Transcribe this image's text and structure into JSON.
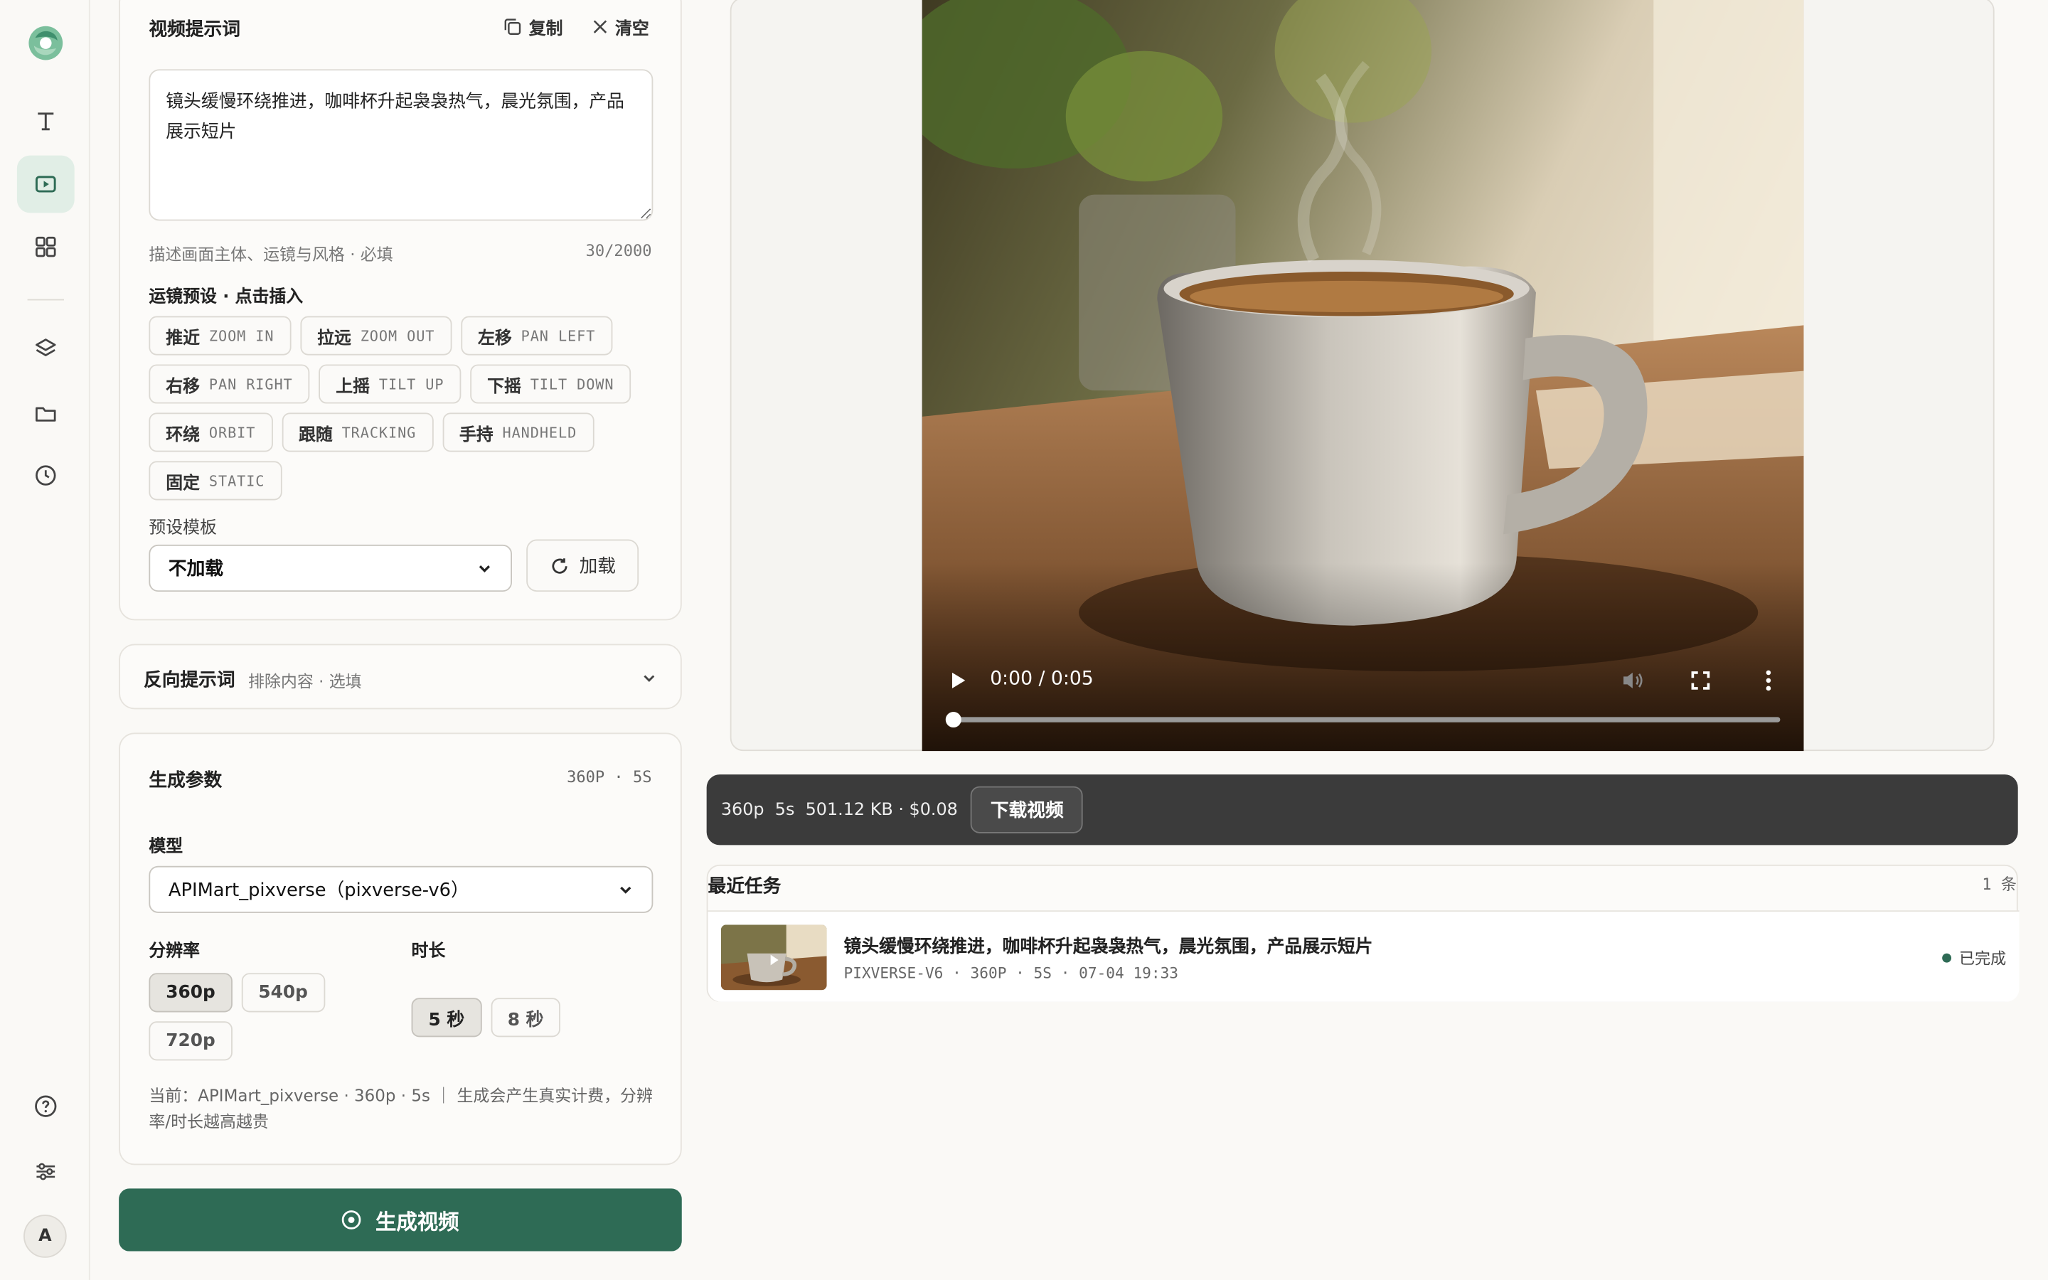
{
  "prompt": {
    "title": "视频提示词",
    "copy_label": "复制",
    "clear_label": "清空",
    "text": "镜头缓慢环绕推进，咖啡杯升起袅袅热气，晨光氛围，产品展示短片",
    "hint": "描述画面主体、运镜与风格 · 必填",
    "count": "30/2000"
  },
  "camera": {
    "title": "运镜预设 · 点击插入",
    "presets": [
      {
        "cn": "推近",
        "en": "ZOOM IN"
      },
      {
        "cn": "拉远",
        "en": "ZOOM OUT"
      },
      {
        "cn": "左移",
        "en": "PAN LEFT"
      },
      {
        "cn": "右移",
        "en": "PAN RIGHT"
      },
      {
        "cn": "上摇",
        "en": "TILT UP"
      },
      {
        "cn": "下摇",
        "en": "TILT DOWN"
      },
      {
        "cn": "环绕",
        "en": "ORBIT"
      },
      {
        "cn": "跟随",
        "en": "TRACKING"
      },
      {
        "cn": "手持",
        "en": "HANDHELD"
      },
      {
        "cn": "固定",
        "en": "STATIC"
      }
    ]
  },
  "template": {
    "label": "预设模板",
    "selected": "不加载",
    "load_label": "加载"
  },
  "negative": {
    "title": "反向提示词",
    "subtitle": "排除内容 · 选填"
  },
  "params": {
    "title": "生成参数",
    "summary": "360P · 5S",
    "model_label": "模型",
    "model_selected": "APIMart_pixverse（pixverse-v6）",
    "resolution_label": "分辨率",
    "resolutions": [
      "360p",
      "540p",
      "720p"
    ],
    "resolution_selected": 0,
    "duration_label": "时长",
    "durations": [
      "5 秒",
      "8 秒"
    ],
    "duration_selected": 0,
    "note": "当前：APIMart_pixverse · 360p · 5s ｜ 生成会产生真实计费，分辨率/时长越高越贵"
  },
  "generate_label": "生成视频",
  "player": {
    "time": "0:00 / 0:05",
    "progress": 0.0
  },
  "video_info": {
    "text": "360p  5s  501.12 KB · $0.08",
    "download_label": "下载视频"
  },
  "recent": {
    "title": "最近任务",
    "count": "1 条",
    "tasks": [
      {
        "title": "镜头缓慢环绕推进，咖啡杯升起袅袅热气，晨光氛围，产品展示短片",
        "meta": "PIXVERSE-V6 · 360P · 5S · 07-04 19:33",
        "status": "已完成"
      }
    ]
  },
  "user": {
    "initial": "A"
  },
  "colors": {
    "accent": "#2e6b55",
    "active_nav": "#e1eee6",
    "status_done": "#2e6b55"
  }
}
